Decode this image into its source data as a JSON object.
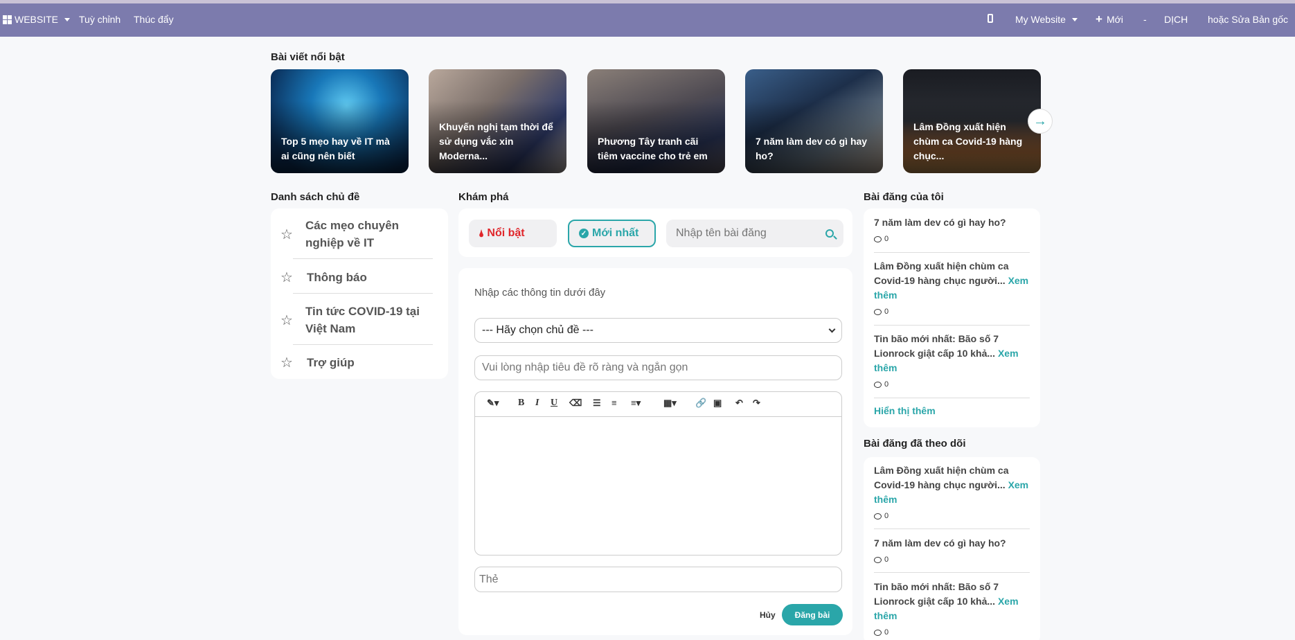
{
  "topbar": {
    "website": "WEBSITE",
    "customize": "Tuỳ chỉnh",
    "promote": "Thúc đẩy",
    "my_website": "My Website",
    "new": "Mới",
    "lang_sep": "-",
    "translate": "DỊCH",
    "edit_source": "hoặc Sửa Bản gốc"
  },
  "featured": {
    "title": "Bài viết nổi bật",
    "cards": [
      {
        "caption": "Top 5 mẹo hay về IT mà ai cũng nên biết"
      },
      {
        "caption": "Khuyến nghị tạm thời để sử dụng vắc xin Moderna..."
      },
      {
        "caption": "Phương Tây tranh cãi tiêm vaccine cho trẻ em"
      },
      {
        "caption": "7 năm làm dev có gì hay ho?"
      },
      {
        "caption": "Lâm Đồng xuất hiện chùm ca Covid-19 hàng chục..."
      }
    ]
  },
  "topics": {
    "title": "Danh sách chủ đề",
    "items": [
      {
        "label": "Các mẹo chuyên nghiệp về IT"
      },
      {
        "label": "Thông báo"
      },
      {
        "label": "Tin tức COVID-19 tại Việt Nam"
      },
      {
        "label": "Trợ giúp"
      }
    ]
  },
  "explore": {
    "title": "Khám phá",
    "featured_tab": "Nổi bật",
    "latest_tab": "Mới nhất",
    "search_placeholder": "Nhập tên bài đăng"
  },
  "form": {
    "intro": "Nhập các thông tin dưới đây",
    "topic_select": "--- Hãy chọn chủ đề ---",
    "title_placeholder": "Vui lòng nhập tiêu đề rõ ràng và ngắn gọn",
    "tags_placeholder": "Thẻ",
    "cancel": "Hủy",
    "submit": "Đăng bài"
  },
  "my_posts": {
    "title": "Bài đăng của tôi",
    "items": [
      {
        "title": "7 năm làm dev có gì hay ho?",
        "more": "",
        "count": "0"
      },
      {
        "title": "Lâm Đồng xuất hiện chùm ca Covid-19 hàng chục người...",
        "more": "Xem thêm",
        "count": "0"
      },
      {
        "title": "Tin bão mới nhất: Bão số 7 Lionrock giật cấp 10 khả...",
        "more": "Xem thêm",
        "count": "0"
      }
    ],
    "show_more": "Hiển thị thêm"
  },
  "followed_posts": {
    "title": "Bài đăng đã theo dõi",
    "items": [
      {
        "title": "Lâm Đồng xuất hiện chùm ca Covid-19 hàng chục người...",
        "more": "Xem thêm",
        "count": "0"
      },
      {
        "title": "7 năm làm dev có gì hay ho?",
        "more": "",
        "count": "0"
      },
      {
        "title": "Tin bão mới nhất: Bão số 7 Lionrock giật cấp 10 khả...",
        "more": "Xem thêm",
        "count": "0"
      }
    ]
  },
  "colors": {
    "navbar": "#7c7bad",
    "accent": "#2aa6a9",
    "featured_red": "#e0262b"
  }
}
